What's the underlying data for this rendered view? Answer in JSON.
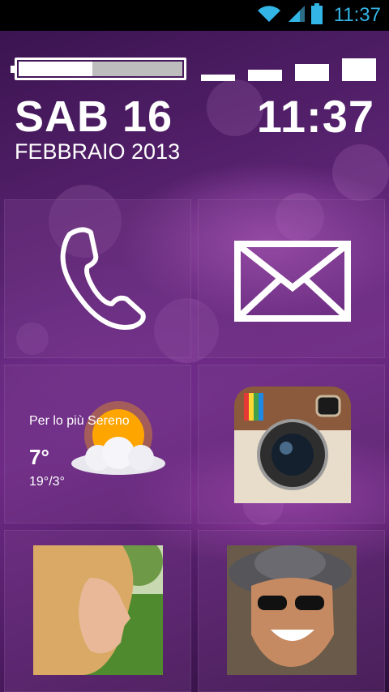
{
  "status_bar": {
    "time": "11:37",
    "accent_color": "#33b5e5",
    "icons": [
      "wifi-icon",
      "signal-icon",
      "battery-icon"
    ]
  },
  "lockscreen": {
    "battery_level": 0.45,
    "signal_bars": 4,
    "date_day": "SAB 16",
    "date_month": "FEBBRAIO 2013",
    "time": "11:37"
  },
  "tiles": {
    "phone": {
      "icon": "phone-icon"
    },
    "mail": {
      "icon": "envelope-icon"
    },
    "weather": {
      "condition": "Per lo più Sereno",
      "temperature": "7°",
      "range": "19°/3°",
      "icon": "sun-cloud-icon"
    },
    "camera_app": {
      "icon": "instagram-camera-icon"
    },
    "contact_1": {
      "icon": "contact-photo-woman"
    },
    "contact_2": {
      "icon": "contact-photo-man"
    }
  }
}
